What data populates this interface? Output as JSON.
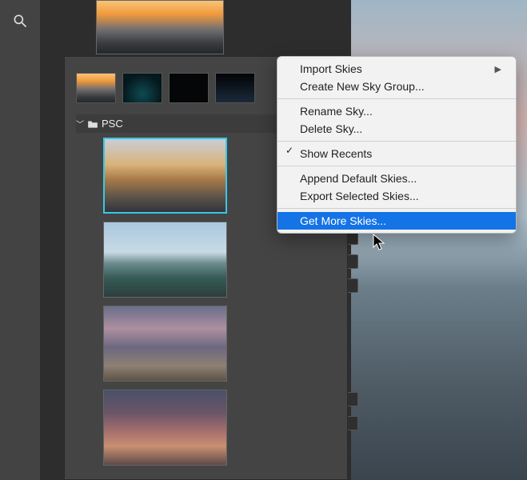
{
  "sidebar": {
    "zoom_tool": "zoom-icon"
  },
  "panel": {
    "gear": "gear-icon",
    "group_name": "PSC",
    "small_thumbs": [
      "sky-sunset1",
      "sky-night1",
      "sky-night2",
      "sky-night3"
    ],
    "large_thumbs": [
      {
        "key": "sky-sunset2",
        "selected": true
      },
      {
        "key": "sky-coast",
        "selected": false
      },
      {
        "key": "sky-beach",
        "selected": false
      },
      {
        "key": "sky-dusk",
        "selected": false
      }
    ]
  },
  "menu": {
    "import": "Import Skies",
    "create_group": "Create New Sky Group...",
    "rename": "Rename Sky...",
    "delete": "Delete Sky...",
    "show_recents": "Show Recents",
    "append_default": "Append Default Skies...",
    "export_selected": "Export Selected Skies...",
    "get_more": "Get More Skies..."
  }
}
